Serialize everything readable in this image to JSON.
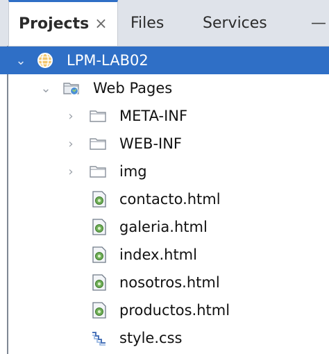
{
  "tabs": {
    "projects_label": "Projects",
    "projects_close": "×",
    "files_label": "Files",
    "services_label": "Services",
    "minimize": "—"
  },
  "tree": {
    "project": {
      "label": "LPM-LAB02",
      "icon": "globe-icon"
    },
    "web_pages": {
      "label": "Web Pages",
      "icon": "web-folder-icon"
    },
    "folders": [
      {
        "label": "META-INF",
        "icon": "folder-icon"
      },
      {
        "label": "WEB-INF",
        "icon": "folder-icon"
      },
      {
        "label": "img",
        "icon": "folder-icon"
      }
    ],
    "files": [
      {
        "label": "contacto.html",
        "icon": "html-file-icon"
      },
      {
        "label": "galeria.html",
        "icon": "html-file-icon"
      },
      {
        "label": "index.html",
        "icon": "html-file-icon"
      },
      {
        "label": "nosotros.html",
        "icon": "html-file-icon"
      },
      {
        "label": "productos.html",
        "icon": "html-file-icon"
      },
      {
        "label": "style.css",
        "icon": "css-file-icon"
      }
    ]
  },
  "colors": {
    "selection": "#2f6fc6",
    "tab_accent": "#2f6fc6",
    "tabstrip_bg": "#dfe3ea"
  }
}
